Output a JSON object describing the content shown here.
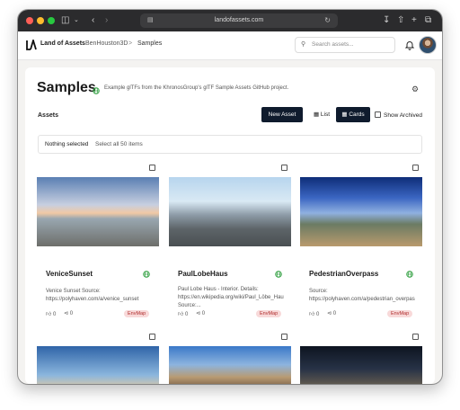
{
  "browser": {
    "url": "landofassets.com"
  },
  "app": {
    "brand": "Land of Assets",
    "breadcrumb": [
      "BenHouston3D",
      "Samples"
    ],
    "breadcrumb_separator": ">",
    "search_placeholder": "Search assets..."
  },
  "page": {
    "title": "Samples",
    "subtitle": "Example glTFs from the KhronosGroup's glTF Sample Assets GitHub project."
  },
  "toolbar": {
    "section_label": "Assets",
    "new_asset_label": "New Asset",
    "view_list_label": "List",
    "view_cards_label": "Cards",
    "view_selected": "Cards",
    "show_archived_label": "Show Archived",
    "show_archived_checked": false
  },
  "selection": {
    "status": "Nothing selected",
    "select_all_label": "Select all 50 items"
  },
  "colors": {
    "accent": "#0f1b2d",
    "public_green": "#2e9e3e",
    "badge_bg": "#f8d9d9",
    "badge_text": "#b03030"
  },
  "cards": [
    {
      "name": "VeniceSunset",
      "description": "Venice Sunset Source: https://polyhaven.com/a/venice_sunset",
      "likes": "0",
      "shares": "0",
      "tag": "EnvMap"
    },
    {
      "name": "PaulLobeHaus",
      "description": "Paul Lobe Haus - Interior. Details: https://en.wikipedia.org/wiki/Paul_Löbe_Haus Source:...",
      "likes": "0",
      "shares": "0",
      "tag": "EnvMap"
    },
    {
      "name": "PedestrianOverpass",
      "description": "Source: https://polyhaven.com/a/pedestrian_overpass",
      "likes": "0",
      "shares": "0",
      "tag": "EnvMap"
    }
  ],
  "icons": {
    "visibility": "globe-icon",
    "like": "thumbs-up-icon",
    "share": "share-icon",
    "settings": "gear-icon",
    "notifications": "bell-icon"
  }
}
